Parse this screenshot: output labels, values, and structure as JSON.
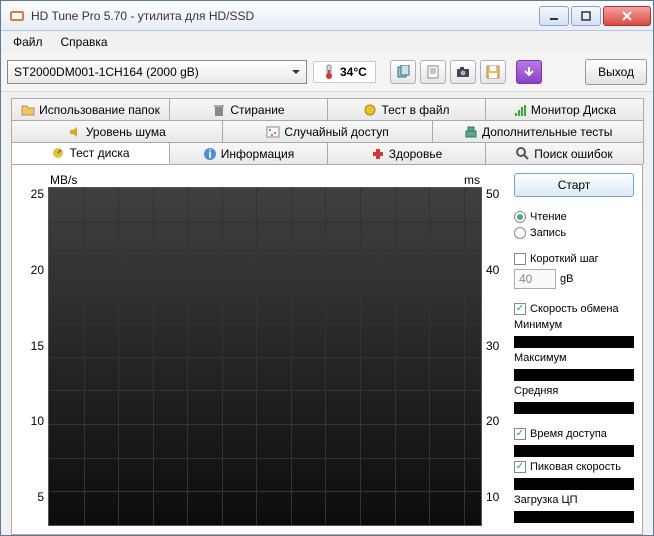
{
  "window": {
    "title": "HD Tune Pro 5.70 - утилита для HD/SSD"
  },
  "menu": {
    "file": "Файл",
    "help": "Справка"
  },
  "toolbar": {
    "drive": "ST2000DM001-1CH164 (2000 gB)",
    "temp": "34°C",
    "exit": "Выход"
  },
  "tabs_row1": [
    {
      "label": "Использование папок",
      "name": "folder-usage"
    },
    {
      "label": "Стирание",
      "name": "erase"
    },
    {
      "label": "Тест в файл",
      "name": "file-test"
    },
    {
      "label": "Монитор Диска",
      "name": "disk-monitor"
    }
  ],
  "tabs_row2": [
    {
      "label": "Уровень шума",
      "name": "noise-level"
    },
    {
      "label": "Случайный доступ",
      "name": "random-access"
    },
    {
      "label": "Дополнительные тесты",
      "name": "extra-tests"
    }
  ],
  "tabs_row3": [
    {
      "label": "Тест диска",
      "name": "disk-test",
      "active": true
    },
    {
      "label": "Информация",
      "name": "info"
    },
    {
      "label": "Здоровье",
      "name": "health"
    },
    {
      "label": "Поиск ошибок",
      "name": "error-scan"
    }
  ],
  "panel": {
    "start": "Старт",
    "read": "Чтение",
    "write": "Запись",
    "short_step": "Короткий шаг",
    "step_value": "40",
    "step_unit": "gB",
    "transfer_rate": "Скорость обмена",
    "minimum": "Минимум",
    "maximum": "Максимум",
    "average": "Средняя",
    "access_time": "Время доступа",
    "burst_rate": "Пиковая скорость",
    "cpu_usage": "Загрузка ЦП"
  },
  "chart_data": {
    "type": "line",
    "title": "",
    "xlabel": "",
    "ylabel_left": "MB/s",
    "ylabel_right": "ms",
    "y_left_ticks": [
      25,
      20,
      15,
      10,
      5
    ],
    "y_right_ticks": [
      50,
      40,
      30,
      20,
      10
    ],
    "ylim": [
      0,
      25
    ],
    "y2lim": [
      0,
      50
    ],
    "series": []
  }
}
